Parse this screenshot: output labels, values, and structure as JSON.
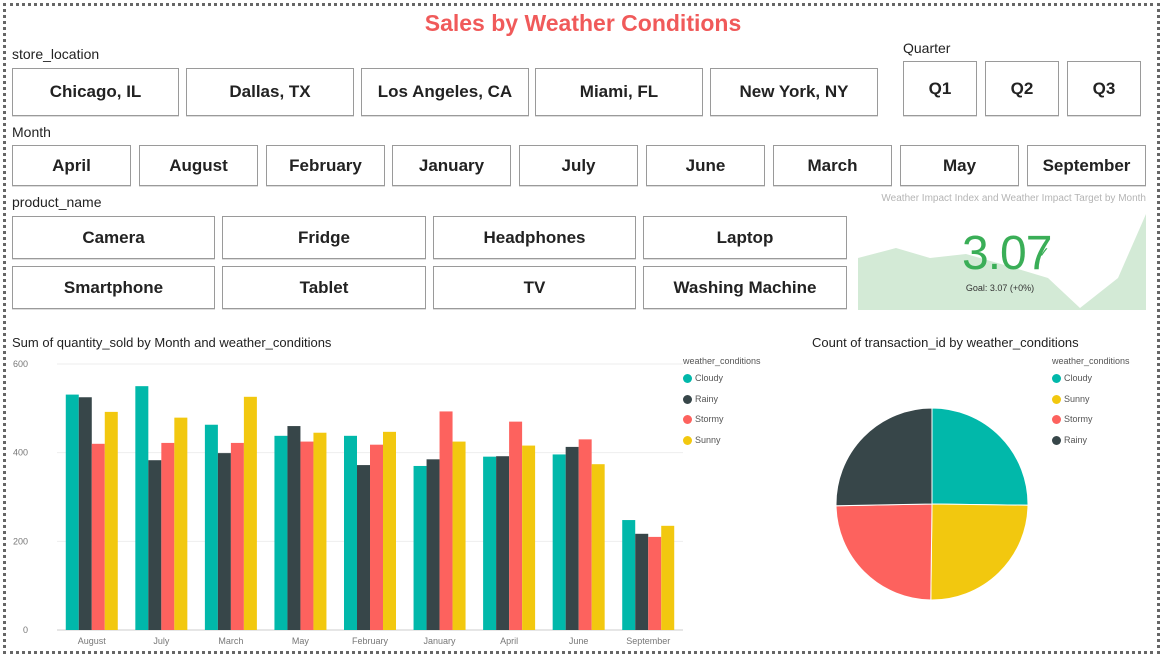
{
  "title": "Sales by Weather Conditions",
  "slicers": {
    "store_location": {
      "label": "store_location",
      "items": [
        "Chicago, IL",
        "Dallas, TX",
        "Los Angeles, CA",
        "Miami, FL",
        "New York, NY"
      ]
    },
    "quarter": {
      "label": "Quarter",
      "items": [
        "Q1",
        "Q2",
        "Q3"
      ]
    },
    "month": {
      "label": "Month",
      "items": [
        "April",
        "August",
        "February",
        "January",
        "July",
        "June",
        "March",
        "May",
        "September"
      ]
    },
    "product_name": {
      "label": "product_name",
      "items": [
        "Camera",
        "Fridge",
        "Headphones",
        "Laptop",
        "Smartphone",
        "Tablet",
        "TV",
        "Washing Machine"
      ]
    }
  },
  "kpi": {
    "title": "Weather Impact Index and Weather Impact Target by Month",
    "value": "3.07",
    "goal": "Goal: 3.07 (+0%)",
    "status_color": "#3aae57"
  },
  "colors": {
    "Cloudy": "#01b8aa",
    "Rainy": "#374649",
    "Stormy": "#fd625e",
    "Sunny": "#f2c80f",
    "title": "#f05a5a"
  },
  "chart_data": [
    {
      "type": "bar",
      "title": "Sum of quantity_sold by Month and weather_conditions",
      "legend_title": "weather_conditions",
      "legend_position": "top-right",
      "categories": [
        "August",
        "July",
        "March",
        "May",
        "February",
        "January",
        "April",
        "June",
        "September"
      ],
      "series": [
        {
          "name": "Cloudy",
          "values": [
            531,
            550,
            463,
            438,
            438,
            370,
            391,
            396,
            248
          ]
        },
        {
          "name": "Rainy",
          "values": [
            525,
            383,
            399,
            460,
            372,
            385,
            392,
            413,
            217
          ]
        },
        {
          "name": "Stormy",
          "values": [
            420,
            422,
            422,
            425,
            418,
            493,
            470,
            430,
            210
          ]
        },
        {
          "name": "Sunny",
          "values": [
            492,
            479,
            526,
            445,
            447,
            425,
            416,
            374,
            235
          ]
        }
      ],
      "yticks": [
        0,
        200,
        400,
        600
      ],
      "ylim": [
        0,
        600
      ],
      "grid": true
    },
    {
      "type": "pie",
      "title": "Count of transaction_id by weather_conditions",
      "legend_title": "weather_conditions",
      "legend_position": "top-right",
      "labels": [
        "Cloudy",
        "Sunny",
        "Stormy",
        "Rainy"
      ],
      "values": [
        25.2,
        25.0,
        24.5,
        25.3
      ]
    }
  ]
}
